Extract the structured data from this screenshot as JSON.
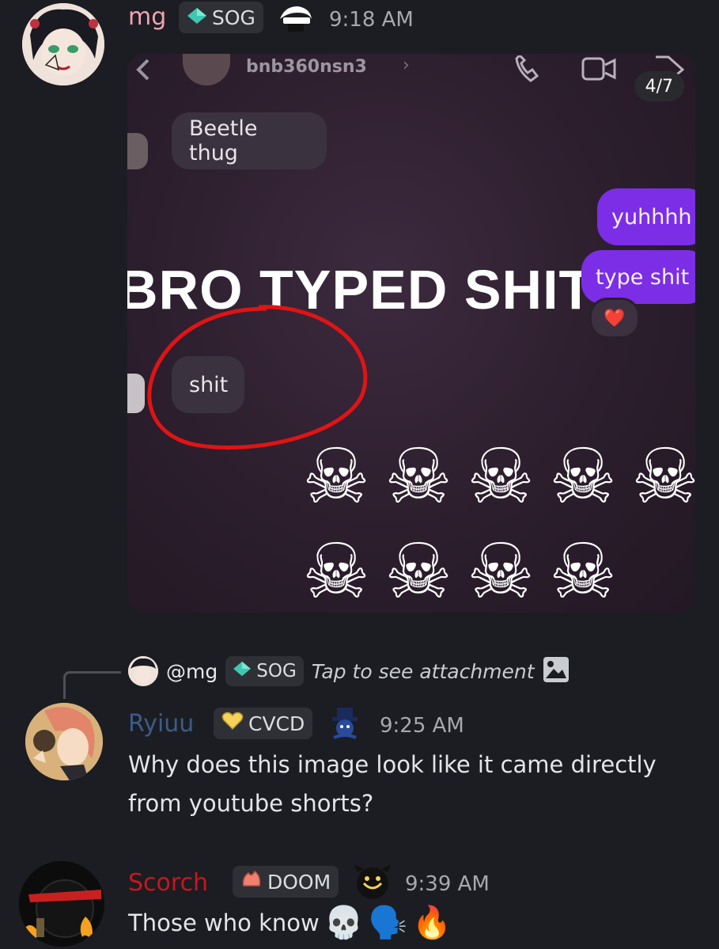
{
  "messages": [
    {
      "username": "mg",
      "username_color": "#f0a3b4",
      "tag": "SOG",
      "time": "9:18 AM",
      "attachment": {
        "counter": "4/7",
        "contact_name": "bnb360nsn3",
        "bubbles": {
          "beetle": "Beetle thug",
          "yuh": "yuhhhh",
          "type": "type shit",
          "reaction": "❤️",
          "shit": "shit"
        },
        "caption": "BRO TYPED SHIT",
        "skull_emoji": "☠"
      }
    },
    {
      "reply_to": {
        "mention": "@mg",
        "tag": "SOG",
        "text": "Tap to see attachment"
      },
      "username": "Ryiuu",
      "username_color": "#3b5c88",
      "tag": "CVCD",
      "time": "9:25 AM",
      "text_line1": "Why does this image look like it came directly",
      "text_line2": "from youtube shorts?"
    },
    {
      "username": "Scorch",
      "username_color": "#c8161d",
      "tag": "DOOM",
      "time": "9:39 AM",
      "text": "Those who know",
      "emojis": [
        "💀",
        "🗣️",
        "🔥"
      ]
    }
  ],
  "colors": {
    "background": "#1c1d22",
    "tag_background": "#2e3036",
    "purple_bubble": "#7b2ee6",
    "sog_gem": "#3fc8b0",
    "cvcd_heart": "#f5d35a",
    "doom_icon": "#f08070"
  }
}
